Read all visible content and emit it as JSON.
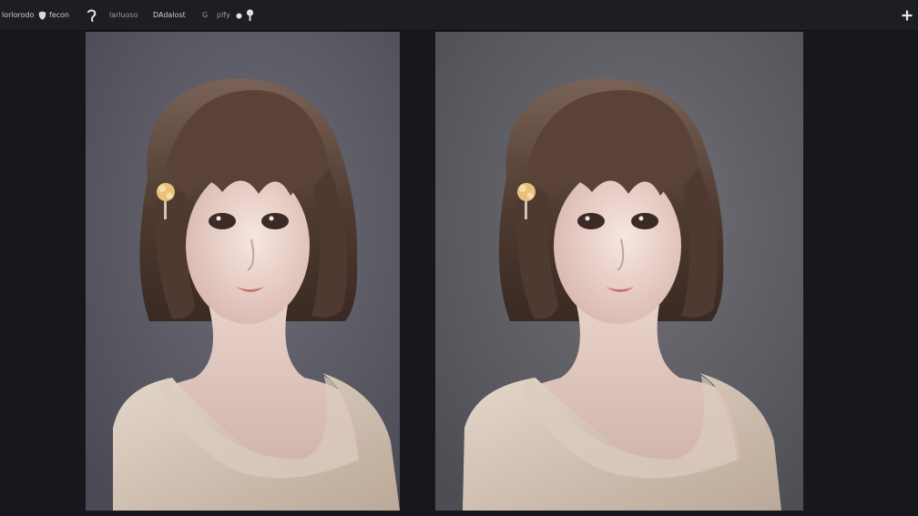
{
  "toolbar": {
    "items": [
      {
        "label": "lorlorodo"
      },
      {
        "label": "fecon"
      },
      {
        "label": "larluoso"
      },
      {
        "label": "DAdalost"
      },
      {
        "label": "G"
      },
      {
        "label": "plfy"
      }
    ],
    "icons": {
      "shield": "shield-icon",
      "spiral": "spiral-icon",
      "dot": "dot-icon",
      "pin": "pin-icon",
      "add": "plus-icon"
    }
  },
  "panels": [
    {
      "name": "image-panel-left",
      "background": "#5c5c66"
    },
    {
      "name": "image-panel-right",
      "background": "#626268"
    }
  ],
  "colors": {
    "app_background": "#17181b",
    "toolbar_background": "#1d1e22",
    "hair": "#5a4236",
    "skin": "#efd8d0",
    "sweater": "#d9cbbd",
    "flower": "#e9c07a"
  }
}
